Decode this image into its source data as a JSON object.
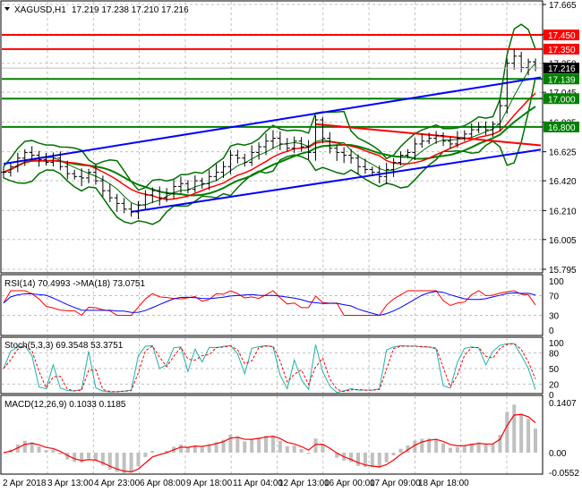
{
  "header": {
    "symbol": "XAGUSD,H1",
    "ohlc": "17.219 17.238 17.210 17.216"
  },
  "chart_data": [
    {
      "type": "line",
      "title": "XAGUSD,H1",
      "ylim": [
        15.795,
        17.665
      ],
      "y_ticks": [
        "17.665",
        "17.455",
        "17.250",
        "17.045",
        "16.835",
        "16.625",
        "16.420",
        "16.210",
        "16.005",
        "15.795"
      ],
      "x_ticks": [
        "2 Apr 2018",
        "3 Apr 13:00",
        "4 Apr 23:00",
        "6 Apr 08:00",
        "9 Apr 18:00",
        "11 Apr 04:00",
        "12 Apr 13:00",
        "16 Apr 00:00",
        "17 Apr 09:00",
        "18 Apr 18:00"
      ],
      "closes": [
        16.48,
        16.52,
        16.58,
        16.62,
        16.6,
        16.57,
        16.55,
        16.58,
        16.52,
        16.47,
        16.45,
        16.44,
        16.48,
        16.42,
        16.35,
        16.3,
        16.26,
        16.22,
        16.2,
        16.25,
        16.32,
        16.35,
        16.3,
        16.33,
        16.38,
        16.4,
        16.36,
        16.42,
        16.4,
        16.45,
        16.48,
        16.52,
        16.6,
        16.58,
        16.55,
        16.62,
        16.66,
        16.7,
        16.72,
        16.68,
        16.65,
        16.7,
        16.66,
        16.62,
        16.85,
        16.72,
        16.65,
        16.62,
        16.6,
        16.58,
        16.52,
        16.5,
        16.48,
        16.45,
        16.5,
        16.55,
        16.6,
        16.62,
        16.68,
        16.7,
        16.72,
        16.74,
        16.7,
        16.68,
        16.72,
        16.75,
        16.78,
        16.8,
        16.78,
        16.82,
        16.95,
        17.25,
        17.3,
        17.22,
        17.26,
        17.216
      ],
      "levels": [
        {
          "value": "17.450",
          "color": "#ff0000"
        },
        {
          "value": "17.350",
          "color": "#ff0000"
        },
        {
          "value": "17.139",
          "color": "#008000"
        },
        {
          "value": "17.000",
          "color": "#008000"
        },
        {
          "value": "16.800",
          "color": "#008000"
        }
      ],
      "current_price": "17.216",
      "trendlines": [
        {
          "color": "#0000ff",
          "from": [
            0,
            16.54
          ],
          "to": [
            75,
            17.15
          ]
        },
        {
          "color": "#0000ff",
          "from": [
            18,
            16.2
          ],
          "to": [
            75,
            16.64
          ]
        },
        {
          "color": "#ff0000",
          "from": [
            44,
            16.82
          ],
          "to": [
            75,
            16.67
          ]
        }
      ]
    },
    {
      "type": "line",
      "title": "RSI(14) 70.4993  ->MA(18) 73.0751",
      "y_ticks": [
        "100",
        "70",
        "30",
        "0"
      ],
      "ylim": [
        0,
        100
      ]
    },
    {
      "type": "line",
      "title": "Stoch(5,3,3) 69.3548 53.3751",
      "y_ticks": [
        "100",
        "80",
        "50",
        "20",
        "0"
      ],
      "ylim": [
        0,
        100
      ]
    },
    {
      "type": "bar",
      "title": "MACD(12,26,9) 0.1033 0.1185",
      "y_ticks": [
        "0.1407",
        "0.00",
        "-0.0552"
      ],
      "ylim": [
        -0.0552,
        0.1407
      ]
    }
  ]
}
